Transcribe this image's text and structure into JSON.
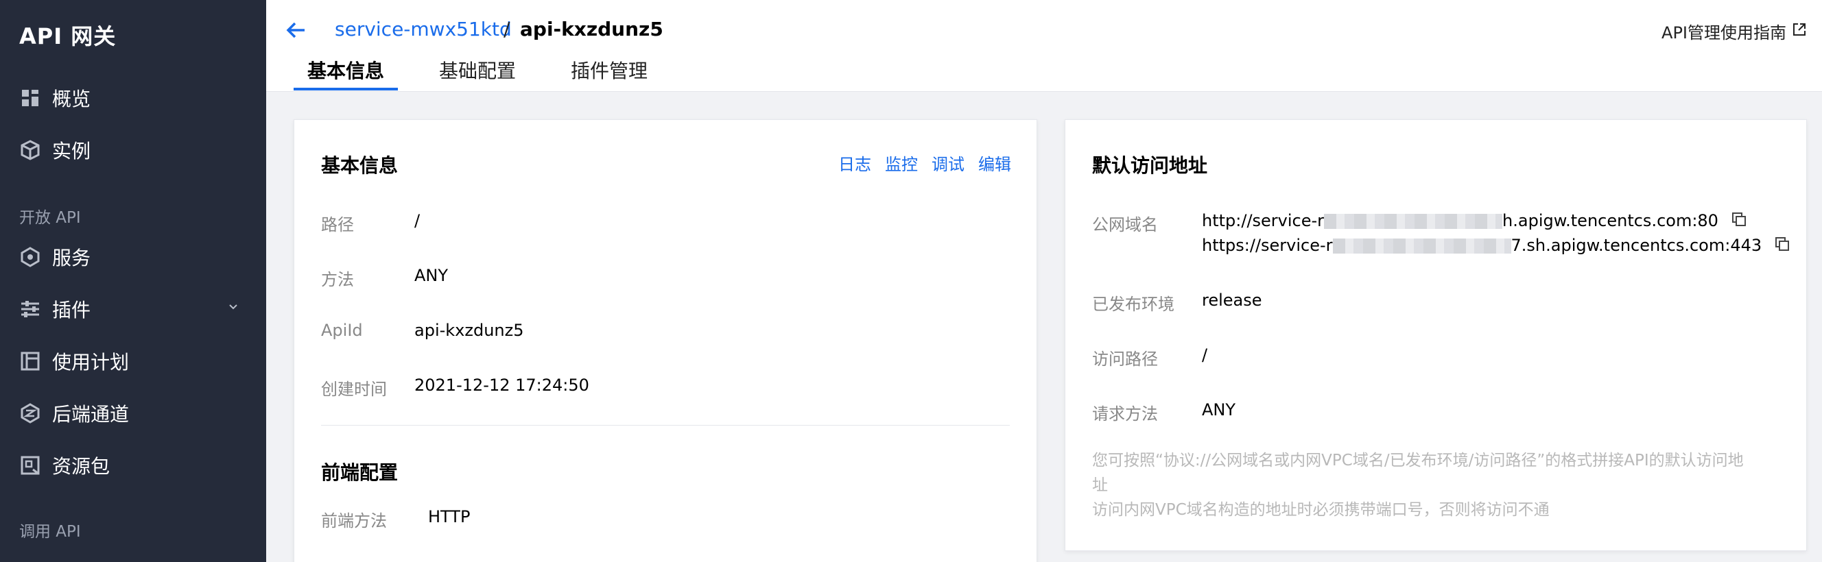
{
  "sidebar": {
    "brand": "API 网关",
    "items": [
      {
        "label": "概览",
        "icon": "dashboard-grid-icon"
      },
      {
        "label": "实例",
        "icon": "cube-icon"
      },
      {
        "label": "服务",
        "icon": "hexagon-icon"
      },
      {
        "label": "插件",
        "icon": "sliders-icon"
      },
      {
        "label": "使用计划",
        "icon": "plan-icon"
      },
      {
        "label": "后端通道",
        "icon": "channel-icon"
      },
      {
        "label": "资源包",
        "icon": "package-icon"
      }
    ],
    "groups": [
      "开放 API",
      "调用 API"
    ]
  },
  "header": {
    "service_link": "service-mwx51ktd",
    "separator": "/",
    "api_name": "api-kxzdunz5",
    "guide": "API管理使用指南",
    "tabs": [
      "基本信息",
      "基础配置",
      "插件管理"
    ]
  },
  "basic_card": {
    "title": "基本信息",
    "actions": [
      "日志",
      "监控",
      "调试",
      "编辑"
    ],
    "rows": [
      {
        "label": "路径",
        "value": "/"
      },
      {
        "label": "方法",
        "value": "ANY"
      },
      {
        "label": "ApiId",
        "value": "api-kxzdunz5"
      },
      {
        "label": "创建时间",
        "value": "2021-12-12 17:24:50"
      }
    ],
    "frontend_title": "前端配置",
    "frontend_rows": [
      {
        "label": "前端方法",
        "value": "HTTP"
      }
    ]
  },
  "access_card": {
    "title": "默认访问地址",
    "public_label": "公网域名",
    "http_prefix": "http://service-r",
    "http_suffix": "h.apigw.tencentcs.com:80",
    "https_prefix": "https://service-r",
    "https_suffix": "7.sh.apigw.tencentcs.com:443",
    "rows": [
      {
        "label": "已发布环境",
        "value": "release"
      },
      {
        "label": "访问路径",
        "value": "/"
      },
      {
        "label": "请求方法",
        "value": "ANY"
      }
    ],
    "hint_line1": "您可按照“协议://公网域名或内网VPC域名/已发布环境/访问路径”的格式拼接API的默认访问地",
    "hint_line2": "址",
    "hint_line3": "访问内网VPC域名构造的地址时必须携带端口号，否则将访问不通"
  },
  "colors": {
    "sidebar_bg": "#252b3a",
    "accent": "#1a6cea",
    "page_bg": "#f1f2f5"
  }
}
